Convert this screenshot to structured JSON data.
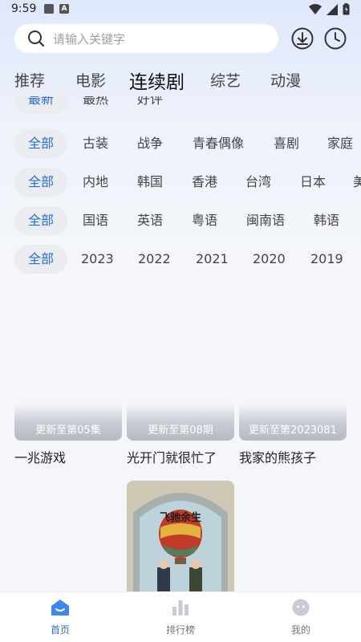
{
  "status": {
    "time": "9:59"
  },
  "search": {
    "placeholder": "请输入关键字"
  },
  "tabs": [
    "推荐",
    "电影",
    "连续剧",
    "综艺",
    "动漫"
  ],
  "filters": {
    "sort": [
      "最新",
      "最热",
      "好评"
    ],
    "genre": [
      "全部",
      "古装",
      "战争",
      "青春偶像",
      "喜剧",
      "家庭"
    ],
    "region": [
      "全部",
      "内地",
      "韩国",
      "香港",
      "台湾",
      "日本",
      "美"
    ],
    "language": [
      "全部",
      "国语",
      "英语",
      "粤语",
      "闽南语",
      "韩语"
    ],
    "year": [
      "全部",
      "2023",
      "2022",
      "2021",
      "2020",
      "2019"
    ]
  },
  "cards": [
    {
      "update": "更新至第05集",
      "title": "一兆游戏"
    },
    {
      "update": "更新至第08期",
      "title": "光开门就很忙了"
    },
    {
      "update": "更新至第2023081",
      "title": "我家的熊孩子"
    }
  ],
  "poster": {
    "title": "飞驰余生"
  },
  "bottom_nav": [
    "首页",
    "排行榜",
    "我的"
  ],
  "colors": {
    "accent": "#2b6fd6",
    "chip_bg": "#eaecf0"
  }
}
